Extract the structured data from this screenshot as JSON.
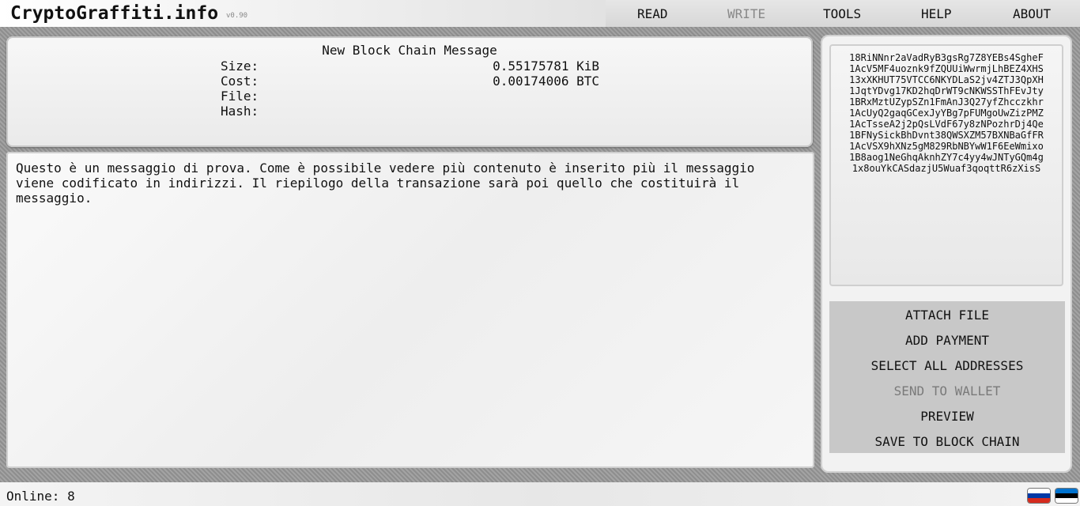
{
  "app": {
    "logo": "CryptoGraffiti.info",
    "version": "v0.90"
  },
  "nav": {
    "read": "READ",
    "write": "WRITE",
    "tools": "TOOLS",
    "help": "HELP",
    "about": "ABOUT"
  },
  "info": {
    "title": "New Block Chain Message",
    "size_label": "Size:",
    "size_value": "0.55175781 KiB",
    "cost_label": "Cost:",
    "cost_value": "0.00174006 BTC",
    "file_label": "File:",
    "file_value": "",
    "hash_label": "Hash:",
    "hash_value": ""
  },
  "message": {
    "text": "Questo è un messaggio di prova. Come è possibile vedere più contenuto è inserito più il messaggio\nviene codificato in indirizzi. Il riepilogo della transazione sarà poi quello che costituirà il\nmessaggio."
  },
  "addresses": [
    "18RiNNnr2aVadRyB3gsRg7Z8YEBs4SgheF",
    "1AcV5MF4uoznk9fZQUUiWwrmjLhBEZ4XHS",
    "13xXKHUT75VTCC6NKYDLaS2jv4ZTJ3QpXH",
    "1JqtYDvg17KD2hqDrWT9cNKWSSThFEvJty",
    "1BRxMztUZypSZn1FmAnJ3Q27yfZhcczkhr",
    "1AcUyQ2gaqGCexJyYBg7pFUMgoUwZizPMZ",
    "1AcTsseA2j2pQsLVdF67y8zNPozhrDj4Qe",
    "1BFNySickBhDvnt38QWSXZM57BXNBaGfFR",
    "1AcVSX9hXNz5gM829RbNBYwW1F6EeWmixo",
    "1B8aog1NeGhqAknhZY7c4yy4wJNTyGQm4g",
    "1x8ouYkCASdazjU5Wuaf3qoqttR6zXisS"
  ],
  "actions": {
    "attach_file": "ATTACH FILE",
    "add_payment": "ADD PAYMENT",
    "select_all": "SELECT ALL ADDRESSES",
    "send_to_wallet": "SEND TO WALLET",
    "preview": "PREVIEW",
    "save_to_chain": "SAVE TO BLOCK CHAIN"
  },
  "status": {
    "online": "Online: 8"
  },
  "flags": [
    {
      "name": "russian-flag-icon",
      "colors": [
        "#ffffff",
        "#0039a6",
        "#d52b1e"
      ]
    },
    {
      "name": "estonian-flag-icon",
      "colors": [
        "#0072ce",
        "#000000",
        "#ffffff"
      ]
    }
  ]
}
